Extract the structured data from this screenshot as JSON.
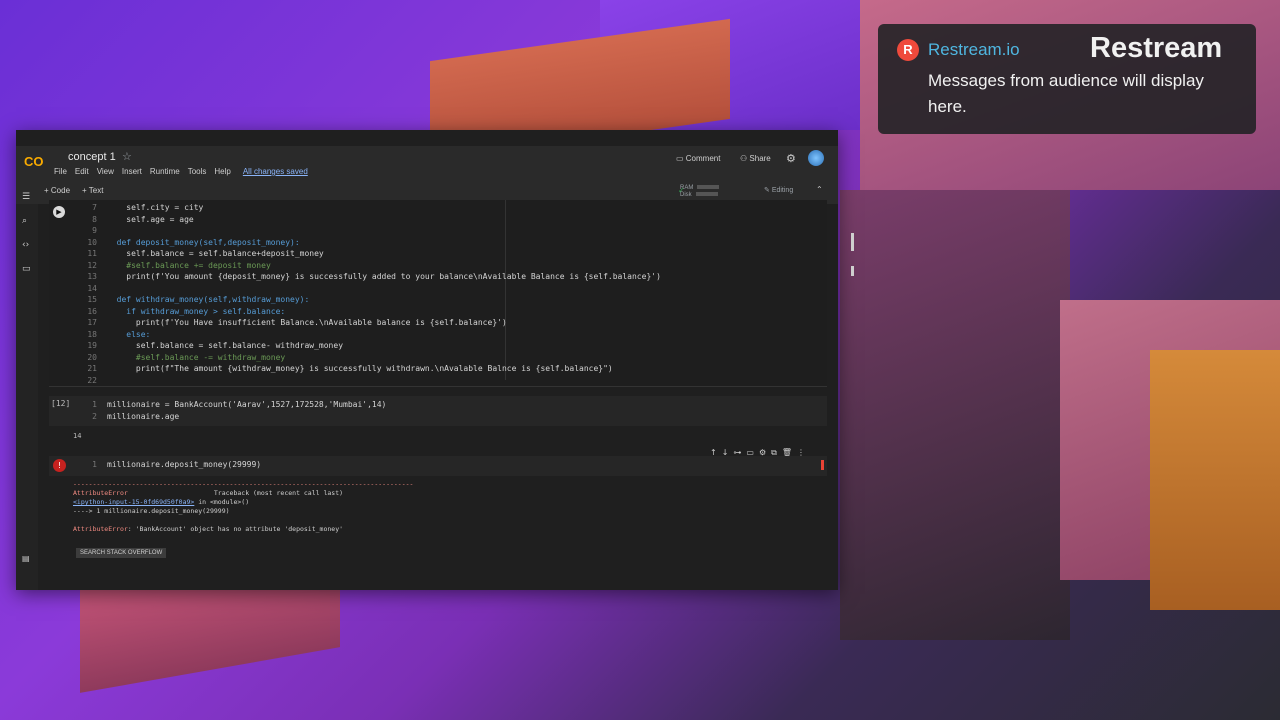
{
  "colab": {
    "notebook_title": "concept 1",
    "menu": [
      "File",
      "Edit",
      "View",
      "Insert",
      "Runtime",
      "Tools",
      "Help"
    ],
    "saved_status": "All changes saved",
    "comment_label": "Comment",
    "share_label": "Share",
    "add_code_label": "+ Code",
    "add_text_label": "+ Text",
    "ram_label": "RAM",
    "disk_label": "Disk",
    "editing_label": "Editing",
    "cell1_lines": [
      {
        "n": "7",
        "t": "    self.city = city"
      },
      {
        "n": "8",
        "t": "    self.age = age"
      },
      {
        "n": "9",
        "t": ""
      },
      {
        "n": "10",
        "t": "  def deposit_money(self,deposit_money):"
      },
      {
        "n": "11",
        "t": "    self.balance = self.balance+deposit_money"
      },
      {
        "n": "12",
        "t": "    #self.balance += deposit money"
      },
      {
        "n": "13",
        "t": "    print(f'You amount {deposit_money} is successfully added to your balance\\nAvailable Balance is {self.balance}')"
      },
      {
        "n": "14",
        "t": ""
      },
      {
        "n": "15",
        "t": "  def withdraw_money(self,withdraw_money):"
      },
      {
        "n": "16",
        "t": "    if withdraw_money > self.balance:"
      },
      {
        "n": "17",
        "t": "      print(f'You Have insufficient Balance.\\nAvailable balance is {self.balance}')"
      },
      {
        "n": "18",
        "t": "    else:"
      },
      {
        "n": "19",
        "t": "      self.balance = self.balance- withdraw_money"
      },
      {
        "n": "20",
        "t": "      #self.balance -= withdraw_money"
      },
      {
        "n": "21",
        "t": "      print(f\"The amount {withdraw_money} is successfully withdrawn.\\nAvalable Balnce is {self.balance}\")"
      },
      {
        "n": "22",
        "t": ""
      }
    ],
    "cell2_number": "[12]",
    "cell2_lines": [
      {
        "n": "1",
        "t": "millionaire = BankAccount('Aarav',1527,172528,'Mumbai',14)"
      },
      {
        "n": "2",
        "t": "millionaire.age"
      }
    ],
    "cell2_output": "14",
    "cell3_lines": [
      {
        "n": "1",
        "t": "millionaire.deposit_money(29999)"
      }
    ],
    "error": {
      "dashes": "---------------------------------------------------------------------------------------",
      "name": "AttributeError",
      "traceback_label": "Traceback (most recent call last)",
      "link": "<ipython-input-15-0fd69d50f0a9>",
      "in_module": " in <module>()",
      "arrow_line": "----> 1 millionaire.deposit_money(29999)",
      "message_name": "AttributeError",
      "message": ": 'BankAccount' object has no attribute 'deposit_money'",
      "so_button": "SEARCH STACK OVERFLOW"
    }
  },
  "restream": {
    "source": "Restream.io",
    "brand": "Restream",
    "message": "Messages from audience will display here."
  }
}
